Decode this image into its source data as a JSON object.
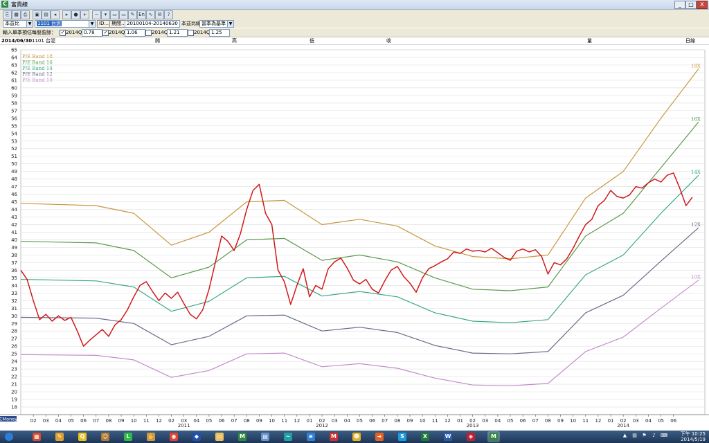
{
  "window": {
    "title": "富貴線",
    "app_icon": "app-icon",
    "controls": [
      "_",
      "□",
      "X"
    ]
  },
  "toolbar_icons": [
    "copy-icon",
    "table-icon",
    "print-icon",
    "save-icon",
    "grid-icon",
    "prev-icon",
    "next-icon",
    "record-icon",
    "zoom-in-icon",
    "zoom-out-icon",
    "dropdown-icon",
    "window-icon",
    "window-icon",
    "tools-icon",
    "en-icon",
    "chart-icon",
    "mail-icon",
    "help-icon"
  ],
  "controls": {
    "ratio_type": "本益比",
    "stock_select": "1101 台泥",
    "id_button": "ID...",
    "period_button": "期間...",
    "period_value": "20100104-20140630",
    "ratio_label": "本益比線",
    "ratio_mode": "當季為基準"
  },
  "eps_inputs": {
    "label": "輸入單季預估每股盈餘：",
    "quarters": [
      {
        "name": "2014Q1",
        "checked": true,
        "value": "0.78"
      },
      {
        "name": "2014Q2",
        "checked": true,
        "value": "1.06"
      },
      {
        "name": "2014Q3",
        "checked": false,
        "value": "1.21"
      },
      {
        "name": "2014Q4",
        "checked": false,
        "value": "1.25"
      }
    ]
  },
  "info_bar": {
    "date": "2014/06/30",
    "stock": "1101 台泥",
    "open_label": "開",
    "high_label": "高",
    "low_label": "低",
    "close_label": "收",
    "volume_label": "量",
    "period_label": "日線"
  },
  "chart_data": {
    "type": "line",
    "ylim": [
      17,
      65
    ],
    "y_ticks": [
      18,
      19,
      20,
      21,
      22,
      23,
      24,
      25,
      26,
      27,
      28,
      29,
      30,
      31,
      32,
      33,
      34,
      35,
      36,
      37,
      38,
      39,
      40,
      41,
      42,
      43,
      44,
      45,
      46,
      47,
      48,
      49,
      50,
      51,
      52,
      53,
      54,
      55,
      56,
      57,
      58,
      59,
      60,
      61,
      62,
      63,
      64,
      65
    ],
    "x_range": [
      0,
      54.5
    ],
    "month_ticks": [
      "02",
      "03",
      "04",
      "05",
      "06",
      "07",
      "08",
      "09",
      "10",
      "11",
      "12",
      "02",
      "03",
      "04",
      "05",
      "06",
      "07",
      "08",
      "09",
      "10",
      "11",
      "12",
      "01",
      "02",
      "03",
      "04",
      "05",
      "06",
      "07",
      "08",
      "09",
      "10",
      "11",
      "12",
      "01",
      "02",
      "03",
      "04",
      "05",
      "06",
      "07",
      "08",
      "09",
      "10",
      "11",
      "12",
      "01",
      "02",
      "03",
      "04",
      "05",
      "06"
    ],
    "year_labels": [
      {
        "label": "2011",
        "x": 13
      },
      {
        "label": "2012",
        "x": 24
      },
      {
        "label": "2013",
        "x": 36
      },
      {
        "label": "2014",
        "x": 48
      }
    ],
    "legend": [
      "P/E Band 18",
      "P/E Band 16",
      "P/E Band 14",
      "P/E Band 12",
      "P/E Band 10"
    ],
    "brand_label": "CMoney",
    "series": [
      {
        "name": "P/E Band 18",
        "end_label": "18X",
        "color": "#c8963e",
        "points": [
          [
            0,
            44.8
          ],
          [
            6,
            44.5
          ],
          [
            9,
            43.5
          ],
          [
            12,
            39.3
          ],
          [
            15,
            41
          ],
          [
            18,
            45
          ],
          [
            21,
            45.2
          ],
          [
            24,
            42
          ],
          [
            27,
            42.7
          ],
          [
            30,
            41.8
          ],
          [
            33,
            39.2
          ],
          [
            36,
            37.8
          ],
          [
            39,
            37.5
          ],
          [
            42,
            38
          ],
          [
            45,
            45.5
          ],
          [
            48,
            49
          ],
          [
            51,
            56
          ],
          [
            54,
            62.5
          ]
        ]
      },
      {
        "name": "P/E Band 16",
        "end_label": "16X",
        "color": "#5a9a4a",
        "points": [
          [
            0,
            39.8
          ],
          [
            6,
            39.6
          ],
          [
            9,
            38.6
          ],
          [
            12,
            35
          ],
          [
            15,
            36.4
          ],
          [
            18,
            40
          ],
          [
            21,
            40.2
          ],
          [
            24,
            37.3
          ],
          [
            27,
            38
          ],
          [
            30,
            37.1
          ],
          [
            33,
            35
          ],
          [
            36,
            33.5
          ],
          [
            39,
            33.3
          ],
          [
            42,
            33.8
          ],
          [
            45,
            40.5
          ],
          [
            48,
            43.5
          ],
          [
            51,
            49.5
          ],
          [
            54,
            55.5
          ]
        ]
      },
      {
        "name": "P/E Band 14",
        "end_label": "14X",
        "color": "#3aa888",
        "points": [
          [
            0,
            34.8
          ],
          [
            6,
            34.6
          ],
          [
            9,
            33.8
          ],
          [
            12,
            30.6
          ],
          [
            15,
            31.9
          ],
          [
            18,
            35
          ],
          [
            21,
            35.2
          ],
          [
            24,
            32.6
          ],
          [
            27,
            33.2
          ],
          [
            30,
            32.5
          ],
          [
            33,
            30.4
          ],
          [
            36,
            29.3
          ],
          [
            39,
            29.1
          ],
          [
            42,
            29.5
          ],
          [
            45,
            35.4
          ],
          [
            48,
            38
          ],
          [
            51,
            43.5
          ],
          [
            54,
            48.5
          ]
        ]
      },
      {
        "name": "P/E Band 12",
        "end_label": "12X",
        "color": "#6a6a88",
        "points": [
          [
            0,
            29.8
          ],
          [
            6,
            29.7
          ],
          [
            9,
            29
          ],
          [
            12,
            26.2
          ],
          [
            15,
            27.3
          ],
          [
            18,
            30
          ],
          [
            21,
            30.1
          ],
          [
            24,
            28
          ],
          [
            27,
            28.5
          ],
          [
            30,
            27.8
          ],
          [
            33,
            26.1
          ],
          [
            36,
            25.1
          ],
          [
            39,
            25
          ],
          [
            42,
            25.3
          ],
          [
            45,
            30.4
          ],
          [
            48,
            32.7
          ],
          [
            51,
            37.2
          ],
          [
            54,
            41.6
          ]
        ]
      },
      {
        "name": "P/E Band 10",
        "end_label": "10X",
        "color": "#c48ccc",
        "points": [
          [
            0,
            24.9
          ],
          [
            6,
            24.8
          ],
          [
            9,
            24.2
          ],
          [
            12,
            21.9
          ],
          [
            15,
            22.8
          ],
          [
            18,
            25
          ],
          [
            21,
            25.1
          ],
          [
            24,
            23.3
          ],
          [
            27,
            23.7
          ],
          [
            30,
            23.1
          ],
          [
            33,
            21.8
          ],
          [
            36,
            20.9
          ],
          [
            39,
            20.8
          ],
          [
            42,
            21.1
          ],
          [
            45,
            25.3
          ],
          [
            48,
            27.2
          ],
          [
            51,
            31
          ],
          [
            54,
            34.7
          ]
        ]
      },
      {
        "name": "price",
        "color": "#d01818",
        "points": [
          [
            0,
            36
          ],
          [
            0.5,
            34.8
          ],
          [
            1,
            32
          ],
          [
            1.5,
            29.5
          ],
          [
            2,
            30.2
          ],
          [
            2.5,
            29.3
          ],
          [
            3,
            30
          ],
          [
            3.5,
            29.4
          ],
          [
            4,
            29.8
          ],
          [
            4.5,
            28
          ],
          [
            5,
            26
          ],
          [
            5.5,
            26.8
          ],
          [
            6,
            27.5
          ],
          [
            6.5,
            28.2
          ],
          [
            7,
            27.3
          ],
          [
            7.5,
            28.8
          ],
          [
            8,
            29.5
          ],
          [
            8.5,
            30.8
          ],
          [
            9,
            32.5
          ],
          [
            9.5,
            34
          ],
          [
            10,
            34.5
          ],
          [
            10.5,
            33.2
          ],
          [
            11,
            32
          ],
          [
            11.5,
            33
          ],
          [
            12,
            32.3
          ],
          [
            12.5,
            33.1
          ],
          [
            13,
            31.6
          ],
          [
            13.5,
            30.2
          ],
          [
            14,
            29.6
          ],
          [
            14.5,
            30.8
          ],
          [
            15,
            33.5
          ],
          [
            15.5,
            37
          ],
          [
            16,
            40.5
          ],
          [
            16.5,
            39.8
          ],
          [
            17,
            38.6
          ],
          [
            17.5,
            40.8
          ],
          [
            18,
            44
          ],
          [
            18.5,
            46.5
          ],
          [
            19,
            47.3
          ],
          [
            19.5,
            43.5
          ],
          [
            20,
            42
          ],
          [
            20.5,
            36
          ],
          [
            21,
            34.5
          ],
          [
            21.5,
            31.5
          ],
          [
            22,
            34
          ],
          [
            22.5,
            36.2
          ],
          [
            23,
            32.5
          ],
          [
            23.5,
            34
          ],
          [
            24,
            33.5
          ],
          [
            24.5,
            36.2
          ],
          [
            25,
            37.1
          ],
          [
            25.5,
            37.6
          ],
          [
            26,
            36.3
          ],
          [
            26.5,
            34.7
          ],
          [
            27,
            34.2
          ],
          [
            27.5,
            34.8
          ],
          [
            28,
            33.5
          ],
          [
            28.5,
            33
          ],
          [
            29,
            34.6
          ],
          [
            29.5,
            36
          ],
          [
            30,
            36.5
          ],
          [
            30.5,
            35.2
          ],
          [
            31,
            34.3
          ],
          [
            31.5,
            33.1
          ],
          [
            32,
            35
          ],
          [
            32.5,
            36.2
          ],
          [
            33,
            36.6
          ],
          [
            33.5,
            37.1
          ],
          [
            34,
            37.5
          ],
          [
            34.5,
            38.4
          ],
          [
            35,
            38.2
          ],
          [
            35.5,
            38.8
          ],
          [
            36,
            38.5
          ],
          [
            36.5,
            38.6
          ],
          [
            37,
            38.4
          ],
          [
            37.5,
            38.9
          ],
          [
            38,
            38.3
          ],
          [
            38.5,
            37.7
          ],
          [
            39,
            37.3
          ],
          [
            39.5,
            38.5
          ],
          [
            40,
            38.8
          ],
          [
            40.5,
            38.4
          ],
          [
            41,
            38.7
          ],
          [
            41.5,
            37.8
          ],
          [
            42,
            35.5
          ],
          [
            42.5,
            37
          ],
          [
            43,
            36.7
          ],
          [
            43.5,
            37.5
          ],
          [
            44,
            38.9
          ],
          [
            44.5,
            40.5
          ],
          [
            45,
            42
          ],
          [
            45.5,
            42.7
          ],
          [
            46,
            44.5
          ],
          [
            46.5,
            45.2
          ],
          [
            47,
            46.5
          ],
          [
            47.5,
            45.7
          ],
          [
            48,
            45.5
          ],
          [
            48.5,
            45.9
          ],
          [
            49,
            47
          ],
          [
            49.5,
            46.8
          ],
          [
            50,
            47.5
          ],
          [
            50.5,
            48
          ],
          [
            51,
            47.6
          ],
          [
            51.5,
            48.5
          ],
          [
            52,
            48.8
          ],
          [
            52.5,
            46.8
          ],
          [
            53,
            44.5
          ],
          [
            53.5,
            45.6
          ]
        ]
      }
    ]
  },
  "taskbar": {
    "apps": [
      {
        "name": "start-orb-icon",
        "color": "#2a7fd4",
        "glyph": ""
      },
      {
        "name": "grid-app-icon",
        "color": "#d84a2a",
        "glyph": "▦"
      },
      {
        "name": "pen-app-icon",
        "color": "#e0a030",
        "glyph": "✎"
      },
      {
        "name": "q-app-icon",
        "color": "#e8c020",
        "glyph": "Q"
      },
      {
        "name": "monkey-app-icon",
        "color": "#b07a30",
        "glyph": "☺"
      },
      {
        "name": "line-app-icon",
        "color": "#2fb84a",
        "glyph": "L"
      },
      {
        "name": "reader-app-icon",
        "color": "#c89850",
        "glyph": "✋"
      },
      {
        "name": "chrome-app-icon",
        "color": "#dd4433",
        "glyph": "◉"
      },
      {
        "name": "shield-app-icon",
        "color": "#2050b0",
        "glyph": "◆"
      },
      {
        "name": "folder-app-icon",
        "color": "#e8c060",
        "glyph": "▭"
      },
      {
        "name": "cmoney-app-icon",
        "color": "#2e8b3e",
        "glyph": "M"
      },
      {
        "name": "doc-app-icon",
        "color": "#6a90c8",
        "glyph": "▤"
      },
      {
        "name": "wave-app-icon",
        "color": "#20a0a0",
        "glyph": "~"
      },
      {
        "name": "ie-app-icon",
        "color": "#3080d8",
        "glyph": "e"
      },
      {
        "name": "cmoney-red-app-icon",
        "color": "#d03030",
        "glyph": "M"
      },
      {
        "name": "face-app-icon",
        "color": "#e8b020",
        "glyph": "☻"
      },
      {
        "name": "arrow-app-icon",
        "color": "#e86020",
        "glyph": "➜"
      },
      {
        "name": "skype-app-icon",
        "color": "#1a9ae0",
        "glyph": "S"
      },
      {
        "name": "excel-app-icon",
        "color": "#1f7a3a",
        "glyph": "X"
      },
      {
        "name": "word-app-icon",
        "color": "#2a5aa8",
        "glyph": "W"
      },
      {
        "name": "gem-app-icon",
        "color": "#c02030",
        "glyph": "◈"
      },
      {
        "name": "cmoney-active-app-icon",
        "color": "#2e8b3e",
        "glyph": "M"
      }
    ],
    "tray_icons": [
      "up-arrow-icon",
      "network-icon",
      "flag-icon",
      "speaker-icon",
      "input-icon"
    ],
    "time": "下午 10:25",
    "date": "2014/5/19"
  }
}
